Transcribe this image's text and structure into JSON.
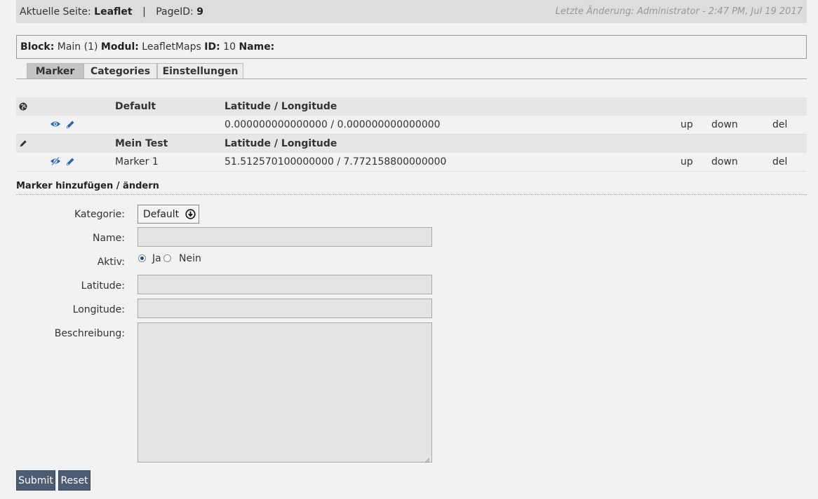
{
  "topbar": {
    "page_prefix": "Aktuelle Seite:",
    "page_name": "Leaflet",
    "separator": "|",
    "pageid_prefix": "PageID:",
    "pageid": "9",
    "last_change": "Letzte Änderung: Administrator - 2:47 PM, Jul 19 2017"
  },
  "blockbar": {
    "block_label": "Block:",
    "block_value": "Main (1)",
    "modul_label": "Modul:",
    "modul_value": "LeafletMaps",
    "id_label": "ID:",
    "id_value": "10",
    "name_label": "Name:",
    "name_value": ""
  },
  "tabs": [
    {
      "label": "Marker",
      "active": true
    },
    {
      "label": "Categories",
      "active": false
    },
    {
      "label": "Einstellungen",
      "active": false
    }
  ],
  "groups": [
    {
      "icon": "globe-icon",
      "name": "Default",
      "latlng_header": "Latitude / Longitude",
      "markers": [
        {
          "name": "",
          "latlng": "0.000000000000000 / 0.000000000000000",
          "visible": true,
          "up": "up",
          "down": "down",
          "del": "del"
        }
      ]
    },
    {
      "icon": "pencil-icon",
      "name": "Mein Test",
      "latlng_header": "Latitude / Longitude",
      "markers": [
        {
          "name": "Marker 1",
          "latlng": "51.512570100000000 / 7.772158800000000",
          "visible": false,
          "up": "up",
          "down": "down",
          "del": "del"
        }
      ]
    }
  ],
  "form": {
    "title": "Marker hinzufügen / ändern",
    "kategorie_label": "Kategorie:",
    "kategorie_value": "Default",
    "name_label": "Name:",
    "name_value": "",
    "aktiv_label": "Aktiv:",
    "aktiv_yes": "Ja",
    "aktiv_no": "Nein",
    "aktiv_selected": "Ja",
    "latitude_label": "Latitude:",
    "latitude_value": "",
    "longitude_label": "Longitude:",
    "longitude_value": "",
    "beschreibung_label": "Beschreibung:",
    "beschreibung_value": "",
    "submit_label": "Submit",
    "reset_label": "Reset"
  },
  "colors": {
    "button_bg": "#4c5d73",
    "icon_blue": "#2a66b0",
    "active_tab": "#c4c4c4"
  }
}
